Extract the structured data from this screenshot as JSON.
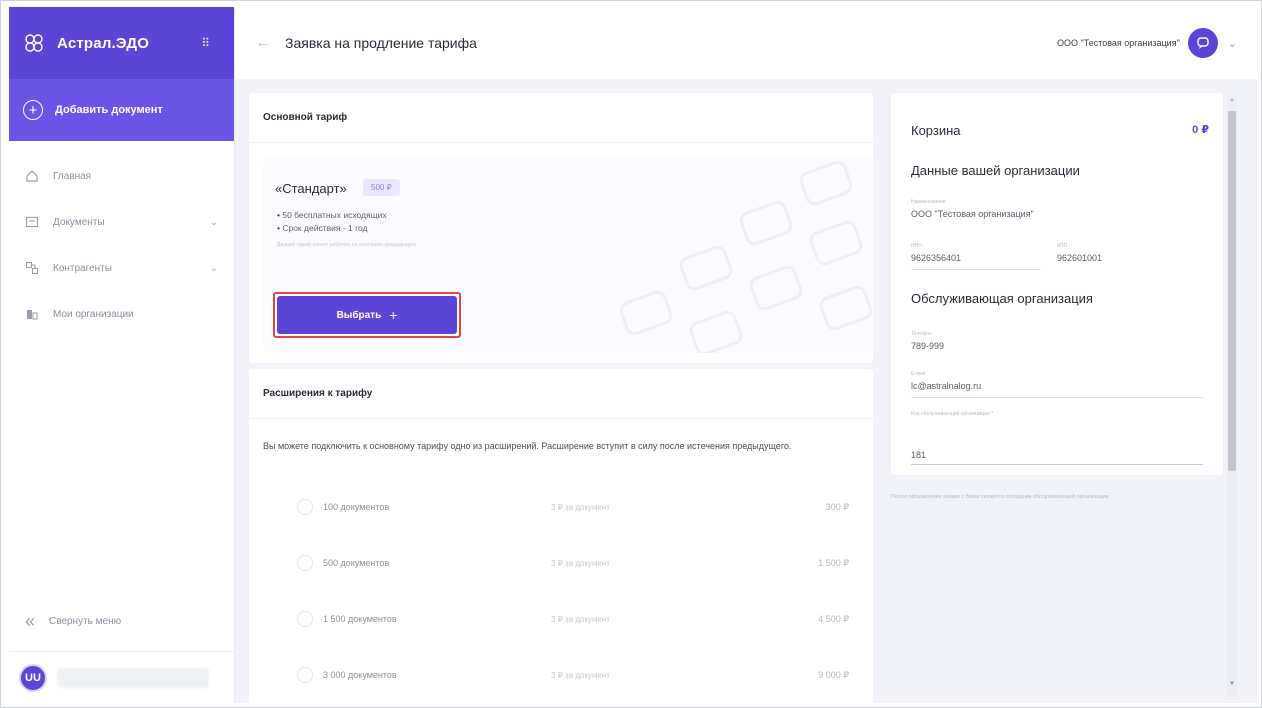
{
  "sidebar": {
    "brand_name": "Астрал.ЭДО",
    "add_document_label": "Добавить документ",
    "items": [
      {
        "label": "Главная",
        "icon": "home-icon"
      },
      {
        "label": "Документы",
        "icon": "documents-icon"
      },
      {
        "label": "Контрагенты",
        "icon": "counterparties-icon"
      },
      {
        "label": "Мои организации",
        "icon": "organizations-icon"
      }
    ],
    "collapse_label": "Свернуть меню",
    "user_initials": "UU"
  },
  "header": {
    "back_icon": "arrow-left-icon",
    "title": "Заявка на продление тарифа",
    "organization": "ООО \"Тестовая организация\""
  },
  "main_tariff": {
    "section_title": "Основной тариф",
    "name": "«Стандарт»",
    "price": "500 ₽",
    "features": [
      "50 бесплатных исходящих",
      "Срок действия - 1 год"
    ],
    "note": "Данный тариф начнет работать по окончании предыдущего",
    "choose_label": "Выбрать",
    "choose_icon": "plus-icon"
  },
  "extensions": {
    "section_title": "Расширения к тарифу",
    "description": "Вы можете подключить к основному тарифу одно из расширений. Расширение вступит в силу после истечения предыдущего.",
    "options": [
      {
        "docs": "100 документов",
        "per_doc": "3 ₽ за документ",
        "price": "300 ₽"
      },
      {
        "docs": "500 документов",
        "per_doc": "3 ₽ за документ",
        "price": "1 500 ₽"
      },
      {
        "docs": "1 500 документов",
        "per_doc": "3 ₽ за документ",
        "price": "4 500 ₽"
      },
      {
        "docs": "3 000 документов",
        "per_doc": "3 ₽ за документ",
        "price": "9 000 ₽"
      }
    ]
  },
  "basket": {
    "title": "Корзина",
    "total": "0 ₽",
    "org_data_title": "Данные вашей организации",
    "name_label": "Наименование",
    "name_value": "ООО \"Тестовая организация\"",
    "inn_label": "ИНН",
    "inn_value": "9626356401",
    "kpp_label": "КПП",
    "kpp_value": "962601001",
    "service_org_title": "Обслуживающая организация",
    "phone_label": "Телефон",
    "phone_value": "789-999",
    "email_label": "E-mail",
    "email_value": "lc@astralnalog.ru",
    "code_label": "Код обслуживающей организации *",
    "code_value": "181",
    "footnote": "После оформления заявки с Вами свяжется сотрудник обслуживающей организации"
  }
}
